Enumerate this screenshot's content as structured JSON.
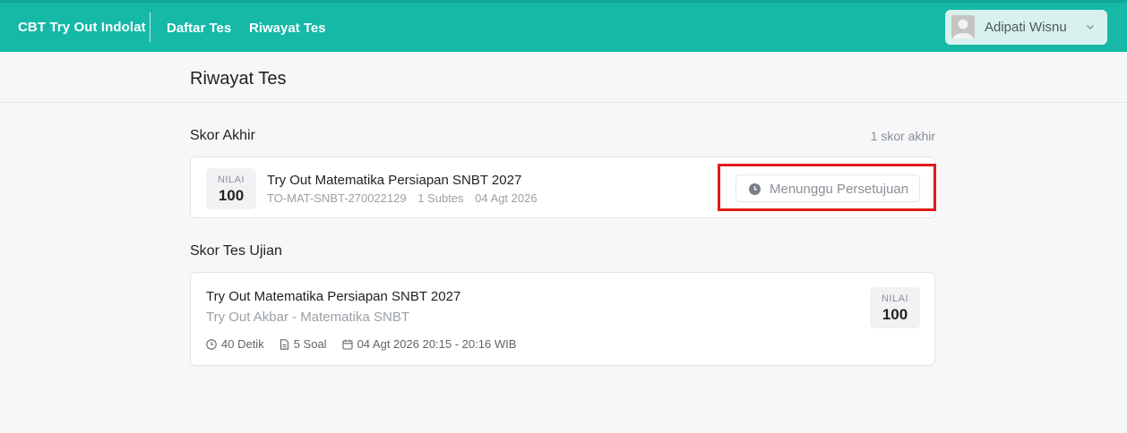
{
  "header": {
    "brand": "CBT Try Out Indolat",
    "nav": [
      {
        "label": "Daftar Tes"
      },
      {
        "label": "Riwayat Tes"
      }
    ],
    "user": {
      "name": "Adipati Wisnu",
      "avatar_icon": "user-avatar-icon",
      "chevron_icon": "chevron-down-icon"
    }
  },
  "page": {
    "title": "Riwayat Tes"
  },
  "skor_akhir": {
    "title": "Skor Akhir",
    "count": "1 skor akhir",
    "card": {
      "score_label": "NILAI",
      "score_value": "100",
      "title": "Try Out Matematika Persiapan SNBT 2027",
      "code": "TO-MAT-SNBT-270022129",
      "subtes": "1 Subtes",
      "date": "04 Agt 2026",
      "status": "Menunggu Persetujuan",
      "status_icon": "clock-icon"
    }
  },
  "skor_ujian": {
    "title": "Skor Tes Ujian",
    "card": {
      "title": "Try Out Matematika Persiapan SNBT 2027",
      "subtitle": "Try Out Akbar - Matematika SNBT",
      "duration": "40 Detik",
      "questions": "5 Soal",
      "datetime": "04 Agt 2026 20:15 - 20:16 WIB",
      "score_label": "NILAI",
      "score_value": "100"
    }
  },
  "colors": {
    "header": "#16b8a6",
    "highlight": "#e01b1b"
  }
}
